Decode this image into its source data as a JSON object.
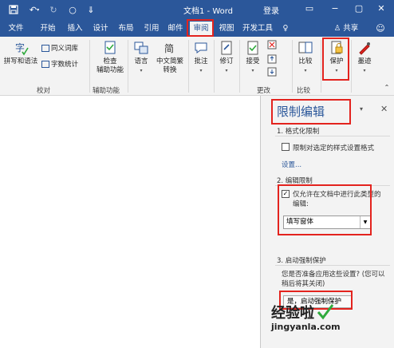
{
  "window": {
    "title": "文档1 - Word",
    "login": "登录"
  },
  "menu": {
    "tabs": [
      "文件",
      "开始",
      "插入",
      "设计",
      "布局",
      "引用",
      "邮件",
      "审阅",
      "视图",
      "开发工具"
    ],
    "active": "审阅",
    "share": "共享"
  },
  "ribbon": {
    "spelling": "拼写和语法",
    "thesaurus": "同义词库",
    "wordcount": "字数统计",
    "group_proofing": "校对",
    "accessibility_line1": "检查",
    "accessibility_line2": "辅助功能",
    "group_accessibility": "辅助功能",
    "language": "语言",
    "chinese_convert_line1": "中文简繁",
    "chinese_convert_line2": "转换",
    "comment": "批注",
    "track": "修订",
    "accept": "接受",
    "group_changes": "更改",
    "compare": "比较",
    "group_compare": "比较",
    "protect": "保护",
    "ink": "墨迹"
  },
  "pane": {
    "title": "限制编辑",
    "sec1": "1. 格式化限制",
    "sec1_option": "限制对选定的样式设置格式",
    "sec1_link": "设置...",
    "sec2": "2. 编辑限制",
    "sec2_option_line1": "仅允许在文档中进行此类型的",
    "sec2_option_line2": "编辑:",
    "sec2_select": "填写窗体",
    "sec3": "3. 启动强制保护",
    "sec3_text_line1": "您是否准备应用这些设置? (您可以",
    "sec3_text_line2": "稍后将其关闭)",
    "sec3_button": "是，启动强制保护"
  },
  "watermark": {
    "cn": "经验啦",
    "url": "jingyanla.com"
  },
  "colors": {
    "accent": "#2b579a",
    "highlight": "#e3231e",
    "check_mark": "#2eaa3c"
  }
}
